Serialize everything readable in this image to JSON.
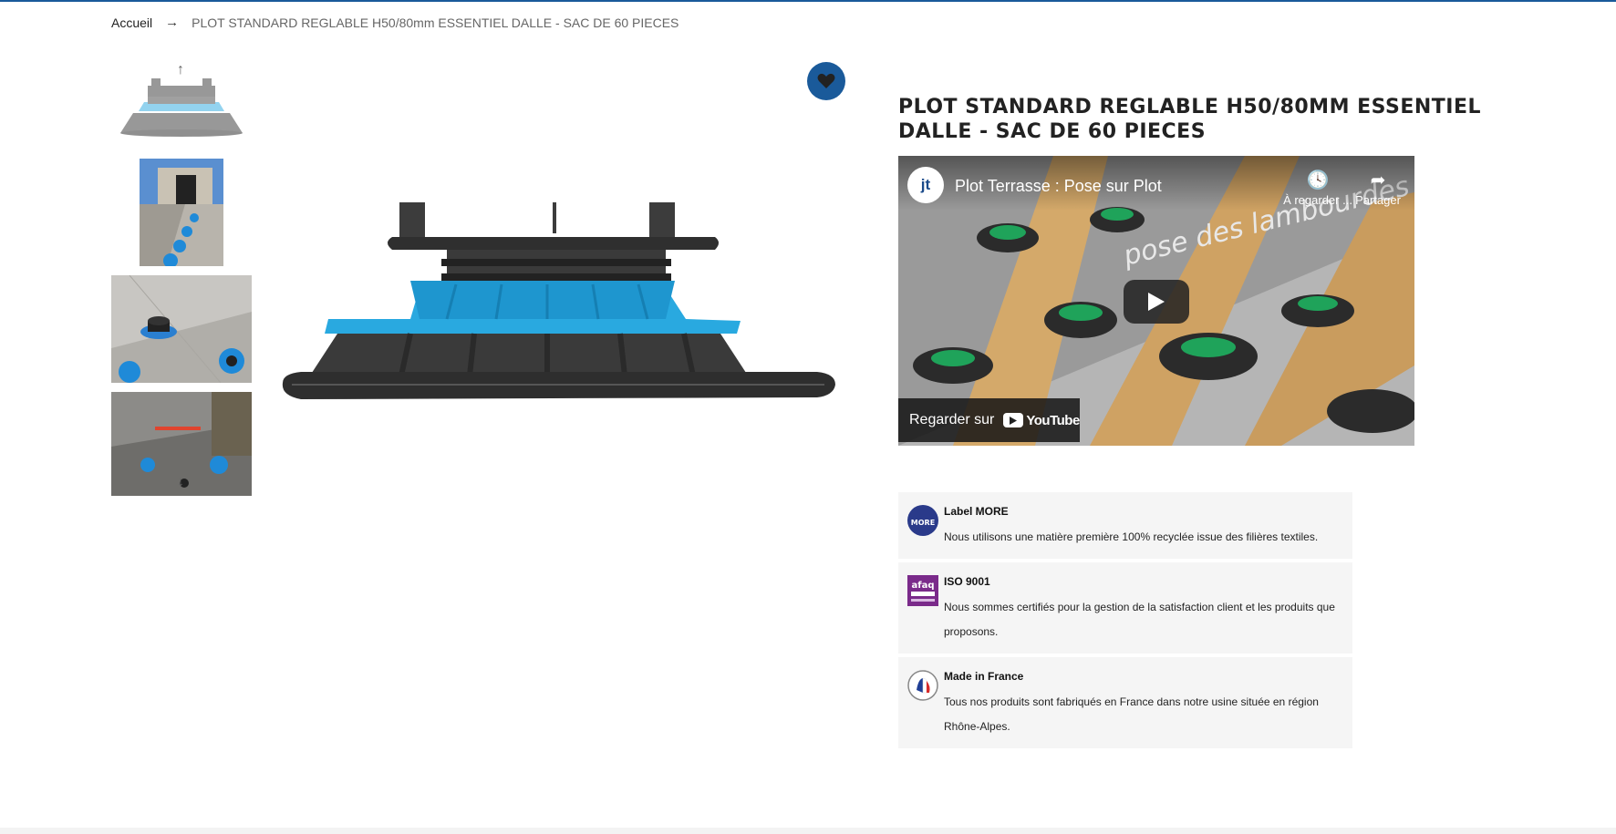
{
  "breadcrumb": {
    "home": "Accueil",
    "separator": "→",
    "current": "PLOT STANDARD REGLABLE H50/80mm ESSENTIEL DALLE - SAC DE 60 PIECES"
  },
  "gallery": {
    "up_icon": "arrow-up-icon",
    "down_icon": "arrow-down-icon",
    "thumbnails": [
      "plot-product",
      "terrace-pedestals-row",
      "tile-on-pedestal",
      "installer-laying-tile"
    ]
  },
  "favorite": {
    "icon": "heart-icon",
    "color": "#1a5a9a"
  },
  "product": {
    "title": "PLOT STANDARD REGLABLE H50/80MM ESSENTIEL DALLE - SAC DE 60 PIECES"
  },
  "video": {
    "channel_logo_text": "jt",
    "title": "Plot Terrasse : Pose sur Plot",
    "overlay_text": "pose des lambourdes",
    "watch_later": "À regarder ...",
    "share": "Partager",
    "watch_on": "Regarder sur",
    "youtube": "YouTube"
  },
  "features": [
    {
      "title": "Label MORE",
      "description": "Nous utilisons une matière première 100% recyclée issue des filières textiles.",
      "badge_text": "MORE"
    },
    {
      "title": "ISO 9001",
      "description": "Nous sommes certifiés pour la gestion de la satisfaction client et les produits que proposons.",
      "badge_text": "afaq"
    },
    {
      "title": "Made in France",
      "description": "Tous nos produits sont fabriqués en France dans notre usine située en région Rhône-Alpes.",
      "badge_text": ""
    }
  ]
}
